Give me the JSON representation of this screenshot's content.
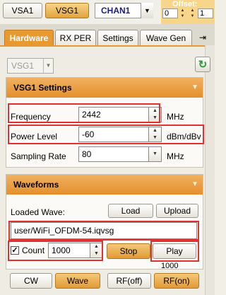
{
  "toolbar": {
    "vsa_label": "VSA1",
    "vsg_label": "VSG1",
    "channel_label": "CHAN1",
    "offset_label": "Offset:",
    "offset_left": "0",
    "offset_right": "1"
  },
  "tabs": [
    {
      "label": "Hardware",
      "active": true
    },
    {
      "label": "RX PER",
      "active": false
    },
    {
      "label": "Settings",
      "active": false
    },
    {
      "label": "Wave Gen",
      "active": false
    }
  ],
  "device_select": "VSG1",
  "vsg_settings": {
    "title": "VSG1 Settings",
    "frequency_label": "Frequency",
    "frequency_value": "2442",
    "frequency_unit": "MHz",
    "power_label": "Power Level",
    "power_value": "-60",
    "power_unit": "dBm/dBv",
    "sampling_label": "Sampling Rate",
    "sampling_value": "80",
    "sampling_unit": "MHz"
  },
  "waveforms": {
    "title": "Waveforms",
    "loaded_wave_label": "Loaded Wave:",
    "load_label": "Load",
    "upload_label": "Upload",
    "wave_file": "user/WiFi_OFDM-54.iqvsg",
    "count_label": "Count",
    "count_value": "1000",
    "count_checked": true,
    "stop_label": "Stop",
    "play_label": "Play",
    "play_count": "1000"
  },
  "bottom": {
    "cw_label": "CW",
    "wave_label": "Wave",
    "rf_off_label": "RF(off)",
    "rf_on_label": "RF(on)"
  },
  "colors": {
    "accent": "#e79a2f",
    "highlight": "#e03030",
    "refresh_icon": "#2a9a3a"
  }
}
